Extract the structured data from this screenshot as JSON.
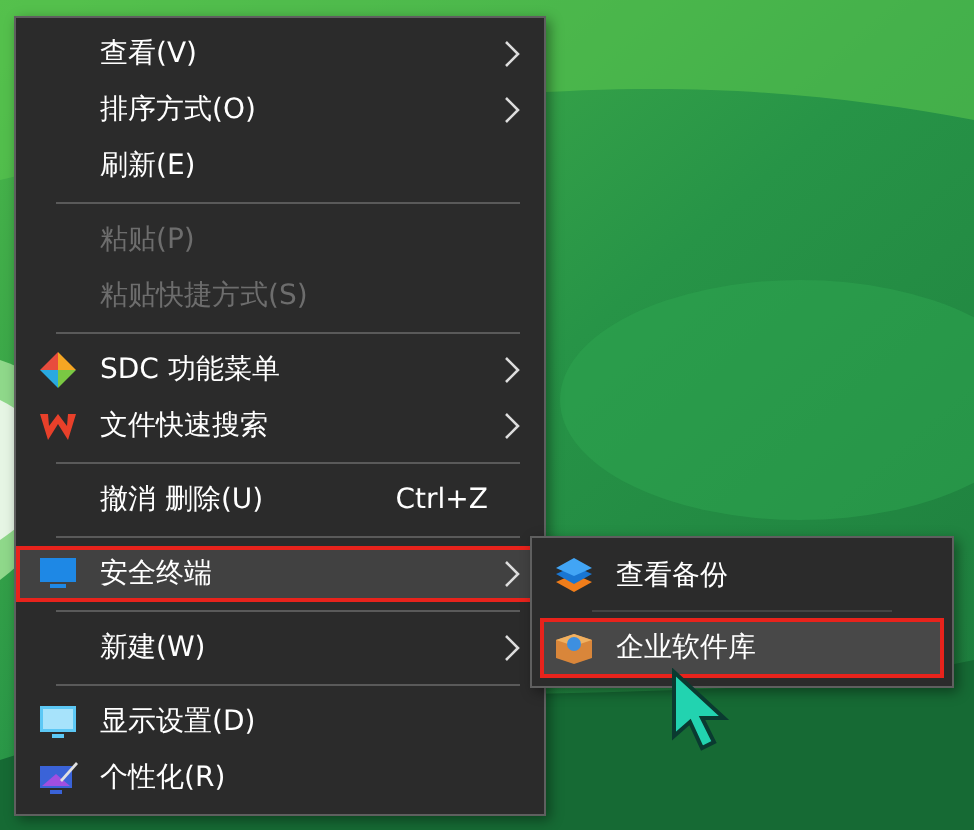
{
  "context_menu": {
    "items": [
      {
        "kind": "item",
        "label": "查看(V)",
        "submenu": true,
        "disabled": false,
        "selected": false,
        "outlined": false
      },
      {
        "kind": "item",
        "label": "排序方式(O)",
        "submenu": true,
        "disabled": false,
        "selected": false,
        "outlined": false
      },
      {
        "kind": "item",
        "label": "刷新(E)",
        "submenu": false,
        "disabled": false,
        "selected": false,
        "outlined": false
      },
      {
        "kind": "separator"
      },
      {
        "kind": "item",
        "label": "粘贴(P)",
        "submenu": false,
        "disabled": true,
        "selected": false,
        "outlined": false
      },
      {
        "kind": "item",
        "label": "粘贴快捷方式(S)",
        "submenu": false,
        "disabled": true,
        "selected": false,
        "outlined": false
      },
      {
        "kind": "separator"
      },
      {
        "kind": "item",
        "label": "SDC 功能菜单",
        "submenu": true,
        "disabled": false,
        "selected": false,
        "outlined": false
      },
      {
        "kind": "item",
        "label": "文件快速搜索",
        "submenu": true,
        "disabled": false,
        "selected": false,
        "outlined": false
      },
      {
        "kind": "separator"
      },
      {
        "kind": "item",
        "label": "撤消 删除(U)",
        "shortcut": "Ctrl+Z",
        "submenu": false,
        "disabled": false,
        "selected": false,
        "outlined": false
      },
      {
        "kind": "separator"
      },
      {
        "kind": "item",
        "label": "安全终端",
        "submenu": true,
        "disabled": false,
        "selected": true,
        "outlined": true
      },
      {
        "kind": "separator"
      },
      {
        "kind": "item",
        "label": "新建(W)",
        "submenu": true,
        "disabled": false,
        "selected": false,
        "outlined": false
      },
      {
        "kind": "separator"
      },
      {
        "kind": "item",
        "label": "显示设置(D)",
        "submenu": false,
        "disabled": false,
        "selected": false,
        "outlined": false
      },
      {
        "kind": "item",
        "label": "个性化(R)",
        "submenu": false,
        "disabled": false,
        "selected": false,
        "outlined": false
      }
    ]
  },
  "submenu": {
    "items": [
      {
        "kind": "item",
        "label": "查看备份",
        "selected": false,
        "outlined": false
      },
      {
        "kind": "separator"
      },
      {
        "kind": "item",
        "label": "企业软件库",
        "selected": true,
        "outlined": true
      }
    ]
  }
}
